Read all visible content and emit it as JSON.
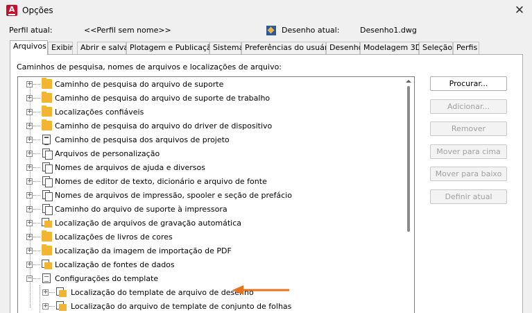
{
  "window": {
    "title": "Opções",
    "close_glyph": "✕"
  },
  "profile": {
    "current_label": "Perfil atual:",
    "current_value": "<<Perfil sem nome>>",
    "drawing_label": "Desenho atual:",
    "drawing_value": "Desenho1.dwg"
  },
  "tabs": [
    {
      "label": "Arquivos",
      "active": true
    },
    {
      "label": "Exibir"
    },
    {
      "label": "Abrir e salvar"
    },
    {
      "label": "Plotagem e Publicação"
    },
    {
      "label": "Sistema"
    },
    {
      "label": "Preferências do usuário"
    },
    {
      "label": "Desenho"
    },
    {
      "label": "Modelagem 3D"
    },
    {
      "label": "Seleção"
    },
    {
      "label": "Perfis"
    }
  ],
  "main": {
    "section_label": "Caminhos de pesquisa, nomes de arquivos e localizações de arquivo:"
  },
  "tree": {
    "items": [
      {
        "label": "Caminho de pesquisa do arquivo de suporte",
        "icon": "folder-icon"
      },
      {
        "label": "Caminho de pesquisa do arquivo de suporte de trabalho",
        "icon": "folder-icon"
      },
      {
        "label": "Localizações confiáveis",
        "icon": "folder-icon"
      },
      {
        "label": "Caminho de pesquisa do arquivo do driver de dispositivo",
        "icon": "folder-icon"
      },
      {
        "label": "Caminho de pesquisa dos arquivos de projeto",
        "icon": "list-icon"
      },
      {
        "label": "Arquivos de personalização",
        "icon": "documents-icon"
      },
      {
        "label": "Nomes de arquivos de ajuda e diversos",
        "icon": "documents-icon"
      },
      {
        "label": "Nomes de editor de texto, dicionário e arquivo de fonte",
        "icon": "documents-icon"
      },
      {
        "label": "Nomes de arquivos de impressão, spooler e seção de prefácio",
        "icon": "documents-icon"
      },
      {
        "label": "Caminho do arquivo de suporte à impressora",
        "icon": "documents-icon"
      },
      {
        "label": "Localização de arquivos de gravação automática",
        "icon": "folder-page-icon"
      },
      {
        "label": "Localizações de livros de cores",
        "icon": "folder-icon"
      },
      {
        "label": "Localização da imagem de importação de PDF",
        "icon": "folder-icon"
      },
      {
        "label": "Localização de fontes de dados",
        "icon": "folder-page-icon"
      },
      {
        "label": "Configurações do template",
        "icon": "template-icon",
        "expanded": true
      },
      {
        "label": "Localização do template de arquivo de desenho",
        "icon": "folder-page-icon",
        "child": true
      },
      {
        "label": "Localização do arquivo de template de conjunto de folhas",
        "icon": "folder-page-icon",
        "child": true
      }
    ]
  },
  "buttons": {
    "browse": "Procurar...",
    "add": "Adicionar...",
    "remove": "Remover",
    "move_up": "Mover para cima",
    "move_down": "Mover para baixo",
    "set_current": "Definir atual"
  },
  "colors": {
    "app_icon": "#c8102e",
    "folder": "#f1b531",
    "arrow": "#e8731e"
  }
}
